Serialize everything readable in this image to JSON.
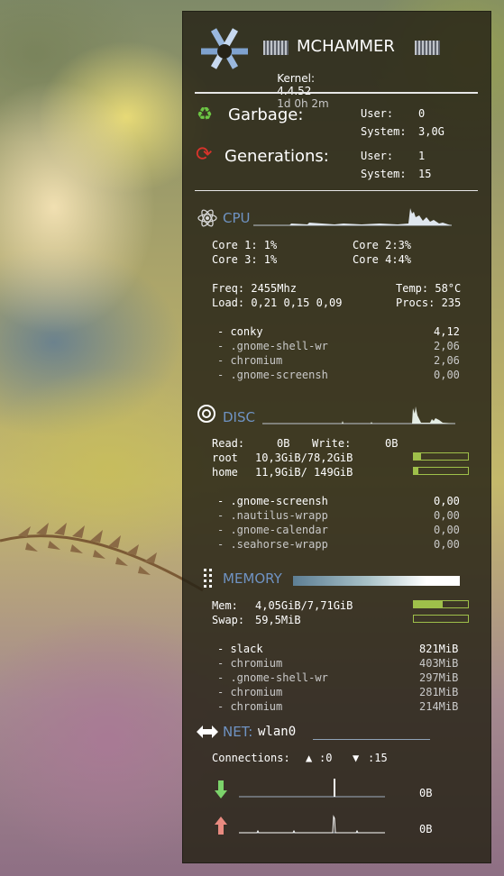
{
  "header": {
    "username": "MCHAMMER",
    "kernel_label": "Kernel:",
    "kernel_version": "4.4.52",
    "uptime": "1d 0h 2m"
  },
  "nix": {
    "garbage_label": "Garbage:",
    "garbage_user_label": "User:",
    "garbage_user_value": "0",
    "garbage_system_label": "System:",
    "garbage_system_value": "3,0G",
    "generations_label": "Generations:",
    "generations_user_label": "User:",
    "generations_user_value": "1",
    "generations_system_label": "System:",
    "generations_system_value": "15"
  },
  "cpu": {
    "title": "CPU",
    "core1": "Core 1: 1%",
    "core2": "Core 2:3%",
    "core3": "Core 3: 1%",
    "core4": "Core 4:4%",
    "freq": "Freq: 2455Mhz",
    "temp": "Temp: 58°C",
    "load": "Load: 0,21 0,15 0,09",
    "procs": "Procs: 235",
    "processes": [
      {
        "name": "- conky",
        "value": "4,12"
      },
      {
        "name": "- .gnome-shell-wr",
        "value": "2,06"
      },
      {
        "name": "- chromium",
        "value": "2,06"
      },
      {
        "name": "- .gnome-screensh",
        "value": "0,00"
      }
    ]
  },
  "disc": {
    "title": "DISC",
    "read_label": "Read:",
    "read_value": "0B",
    "write_label": "Write:",
    "write_value": "0B",
    "root_label": "root",
    "root_usage": "10,3GiB/78,2GiB",
    "root_fraction": 0.13,
    "home_label": "home",
    "home_usage": "11,9GiB/ 149GiB",
    "home_fraction": 0.08,
    "processes": [
      {
        "name": "- .gnome-screensh",
        "value": "0,00"
      },
      {
        "name": "- .nautilus-wrapp",
        "value": "0,00"
      },
      {
        "name": "- .gnome-calendar",
        "value": "0,00"
      },
      {
        "name": "- .seahorse-wrapp",
        "value": "0,00"
      }
    ]
  },
  "memory": {
    "title": "MEMORY",
    "mem_label": "Mem:",
    "mem_usage": "4,05GiB/7,71GiB",
    "mem_fraction": 0.53,
    "swap_label": "Swap:",
    "swap_usage": "59,5MiB",
    "swap_fraction": 0.0,
    "processes": [
      {
        "name": "- slack",
        "value": "821MiB"
      },
      {
        "name": "- chromium",
        "value": "403MiB"
      },
      {
        "name": "- .gnome-shell-wr",
        "value": "297MiB"
      },
      {
        "name": "- chromium",
        "value": "281MiB"
      },
      {
        "name": "- chromium",
        "value": "214MiB"
      }
    ]
  },
  "net": {
    "title": "NET:",
    "interface": "wlan0",
    "connections_label": "Connections:",
    "connections_in": ":0",
    "connections_out": ":15",
    "down_value": "0B",
    "up_value": "0B"
  },
  "colors": {
    "accent": "#6f93c3",
    "bar": "#9fc04a",
    "recycle": "#6cc644",
    "generations": "#d9332b",
    "down_arrow": "#7cd36b",
    "up_arrow": "#e88a80"
  },
  "icons": {
    "logo": "nixos-snowflake-icon",
    "garbage": "recycle-icon",
    "generations": "refresh-icon",
    "cpu": "atom-icon",
    "disc": "disc-icon",
    "memory": "memory-dots-icon",
    "net": "double-arrow-icon",
    "download": "down-arrow-icon",
    "upload": "up-arrow-icon"
  }
}
